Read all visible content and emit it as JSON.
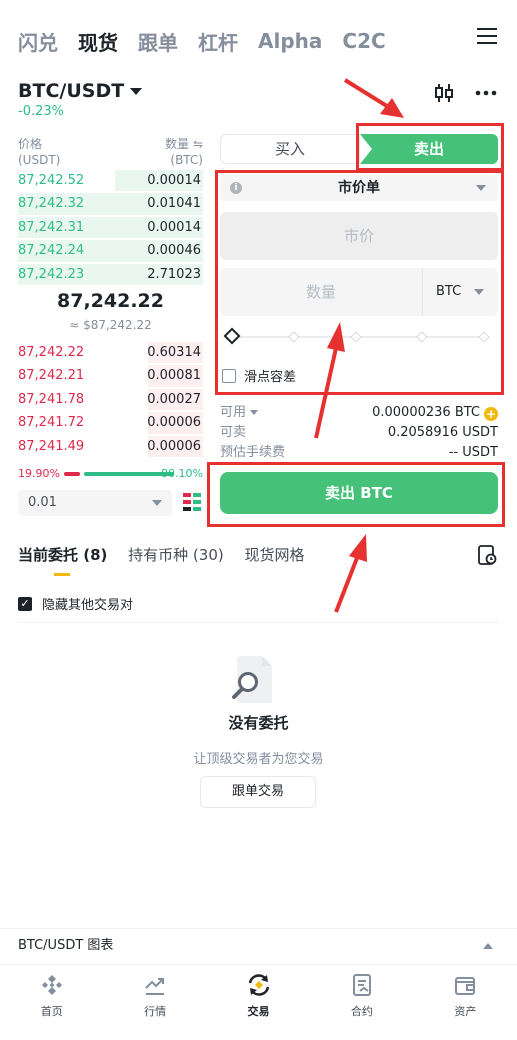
{
  "nav": {
    "tabs": [
      {
        "label": "闪兑"
      },
      {
        "label": "现货"
      },
      {
        "label": "跟单"
      },
      {
        "label": "杠杆"
      },
      {
        "label": "Alpha"
      },
      {
        "label": "C2C"
      }
    ],
    "active": "现货"
  },
  "pair": {
    "symbol": "BTC/USDT",
    "change": "-0.23%"
  },
  "orderbook": {
    "price_header": "价格",
    "price_unit": "(USDT)",
    "qty_header": "数量 ⇋",
    "qty_unit": "(BTC)",
    "asks": [
      {
        "price": "87,242.52",
        "qty": "0.00014"
      },
      {
        "price": "87,242.32",
        "qty": "0.01041"
      },
      {
        "price": "87,242.31",
        "qty": "0.00014"
      },
      {
        "price": "87,242.24",
        "qty": "0.00046"
      },
      {
        "price": "87,242.23",
        "qty": "2.71023"
      }
    ],
    "mid_price": "87,242.22",
    "mid_fiat": "≈ $87,242.22",
    "bids": [
      {
        "price": "87,242.22",
        "qty": "0.60314"
      },
      {
        "price": "87,242.21",
        "qty": "0.00081"
      },
      {
        "price": "87,241.78",
        "qty": "0.00027"
      },
      {
        "price": "87,241.72",
        "qty": "0.00006"
      },
      {
        "price": "87,241.49",
        "qty": "0.00006"
      }
    ],
    "bid_ratio": "19.90%",
    "ask_ratio": "80.10%",
    "precision": "0.01"
  },
  "trade": {
    "buy_label": "买入",
    "sell_label": "卖出",
    "order_type": "市价单",
    "price_placeholder": "市价",
    "qty_placeholder": "数量",
    "qty_unit": "BTC",
    "slippage_label": "滑点容差",
    "available_label": "可用",
    "available_value": "0.00000236 BTC",
    "sellable_label": "可卖",
    "sellable_value": "0.2058916 USDT",
    "fee_label": "预估手续费",
    "fee_value": "-- USDT",
    "submit_label": "卖出 BTC"
  },
  "orders": {
    "tabs": [
      "当前委托 (8)",
      "持有币种 (30)",
      "现货网格"
    ],
    "hide_other_pairs": "隐藏其他交易对",
    "empty_title": "没有委托",
    "empty_sub": "让顶级交易者为您交易",
    "copy_trade_button": "跟单交易"
  },
  "chart_bar": {
    "label": "BTC/USDT 图表"
  },
  "bottom_nav": [
    {
      "label": "首页",
      "icon": "home-icon"
    },
    {
      "label": "行情",
      "icon": "markets-icon"
    },
    {
      "label": "交易",
      "icon": "trade-icon"
    },
    {
      "label": "合约",
      "icon": "futures-icon"
    },
    {
      "label": "资产",
      "icon": "wallet-icon"
    }
  ],
  "colors": {
    "green": "#2ebd85",
    "red": "#e0294a",
    "button_green": "#45c17a",
    "accent_yellow": "#f0b90b",
    "annotation_red": "#e5312f"
  }
}
